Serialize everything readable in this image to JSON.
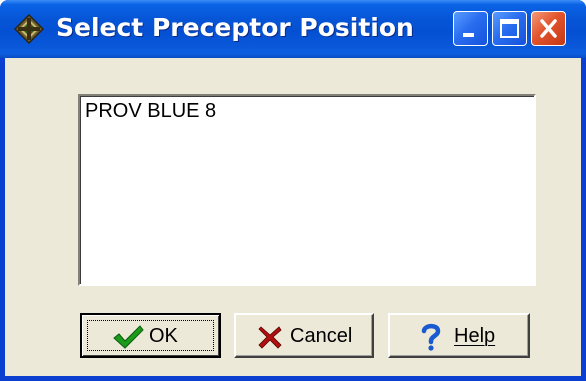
{
  "window": {
    "title": "Select Preceptor Position",
    "controls": {
      "minimize": "minimize-icon",
      "maximize": "maximize-icon",
      "close": "close-icon"
    }
  },
  "list": {
    "items": [
      "PROV BLUE 8"
    ]
  },
  "buttons": {
    "ok": {
      "label": "OK",
      "icon": "checkmark-icon"
    },
    "cancel": {
      "label": "Cancel",
      "icon": "x-icon"
    },
    "help": {
      "label": "Help",
      "icon": "question-icon"
    }
  },
  "colors": {
    "titlebar": "#0550d2",
    "client": "#ece9d8",
    "close_button": "#e2542c",
    "ok_icon": "#1c9a1c",
    "cancel_icon": "#b01010",
    "help_icon": "#1a5ad0"
  }
}
